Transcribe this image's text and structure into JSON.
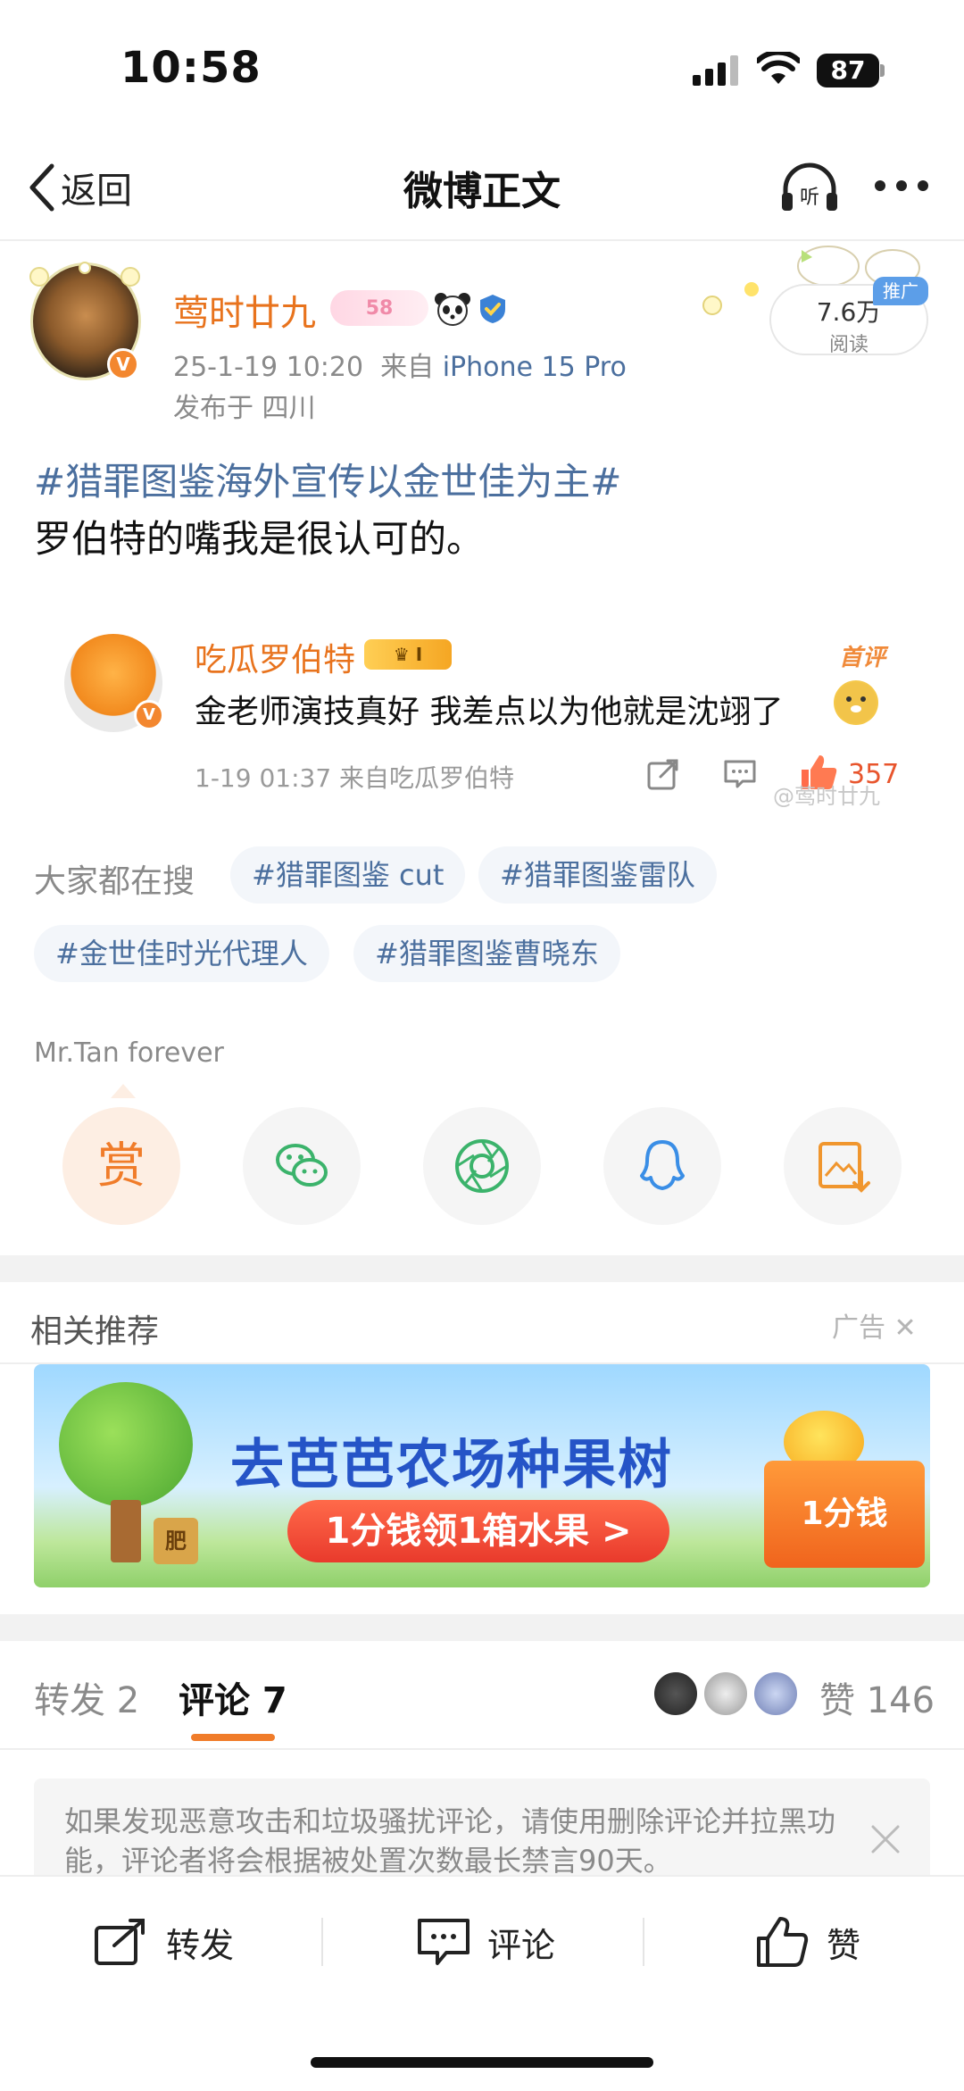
{
  "status_bar": {
    "time": "10:58",
    "battery": "87"
  },
  "nav": {
    "back_label": "返回",
    "title": "微博正文"
  },
  "post": {
    "username": "莺时廿九",
    "level": "58",
    "timestamp": "25-1-19 10:20",
    "source_prefix": "来自",
    "source": "iPhone 15 Pro",
    "location": "发布于 四川",
    "read_count": "7.6万",
    "read_label": "阅读",
    "promo_tag": "推广",
    "topic": "#猎罪图鉴海外宣传以金世佳为主#",
    "text": "罗伯特的嘴我是很认可的。"
  },
  "featured_comment": {
    "username": "吃瓜罗伯特",
    "badge": "I",
    "tag": "首评",
    "text": "金老师演技真好 我差点以为他就是沈翊了",
    "meta": "1-19 01:37 来自吃瓜罗伯特",
    "like_count": "357",
    "watermark": "@莺时廿九"
  },
  "trending": {
    "label": "大家都在搜",
    "chips": [
      "#猎罪图鉴 cut",
      "#猎罪图鉴雷队",
      "#金世佳时光代理人",
      "#猎罪图鉴曹晓东"
    ]
  },
  "tagline": "Mr.Tan forever",
  "share": {
    "reward_label": "赏"
  },
  "related": {
    "title": "相关推荐",
    "ad_label": "广告",
    "ad_title": "去芭芭农场种果树",
    "ad_cta": "1分钱领1箱水果 >",
    "ad_box": "1分钱",
    "ad_bucket": "肥"
  },
  "tabs": {
    "repost": "转发 2",
    "comment": "评论 7",
    "likes": "赞 146"
  },
  "notice": "如果发现恶意攻击和垃圾骚扰评论，请使用删除评论并拉黑功能，评论者将会根据被处置次数最长禁言90天。",
  "bottom_bar": {
    "repost": "转发",
    "comment": "评论",
    "like": "赞"
  },
  "colors": {
    "accent": "#f07c2a",
    "link": "#4b6f9e",
    "username": "#e8731d"
  }
}
